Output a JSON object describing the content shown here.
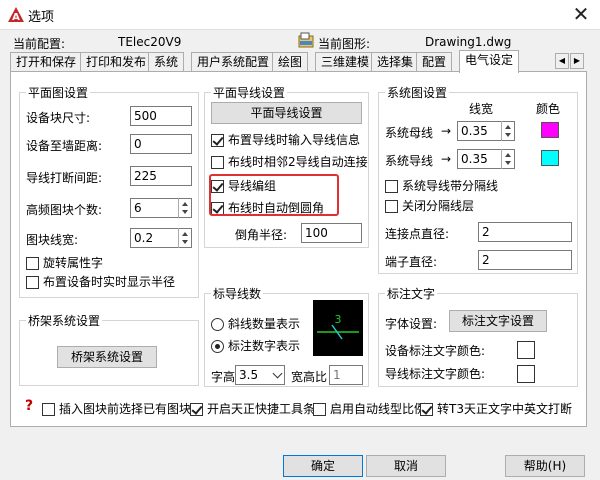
{
  "window": {
    "title": "选项",
    "close_glyph": "✕"
  },
  "info": {
    "config_label": "当前配置:",
    "config_value": "TElec20V9",
    "drawing_label": "当前图形:",
    "drawing_value": "Drawing1.dwg"
  },
  "tabs": [
    "打开和保存",
    "打印和发布",
    "系统",
    "用户系统配置",
    "绘图",
    "三维建模",
    "选择集",
    "配置",
    "电气设定"
  ],
  "tab_scroll": {
    "left": "◀",
    "right": "▶"
  },
  "plane_device": {
    "title": "平面图设置",
    "device_size_label": "设备块尺寸:",
    "device_size_value": "500",
    "device_wall_label": "设备至墙距离:",
    "device_wall_value": "0",
    "wire_gap_label": "导线打断间距:",
    "wire_gap_value": "225",
    "hf_count_label": "高频图块个数:",
    "hf_count_value": "6",
    "line_width_label": "图块线宽:",
    "line_width_value": "0.2",
    "rotate_attr": "旋转属性字",
    "show_radius": "布置设备时实时显示半径"
  },
  "plane_wire": {
    "title": "平面导线设置",
    "button": "平面导线设置",
    "input_info": "布置导线时输入导线信息",
    "auto_connect": "布线时相邻2导线自动连接",
    "group": "导线编组",
    "auto_fillet": "布线时自动倒圆角",
    "fillet_label": "倒角半径:",
    "fillet_value": "100"
  },
  "system_diagram": {
    "title": "系统图设置",
    "col_width": "线宽",
    "col_color": "颜色",
    "bus_label": "系统母线",
    "bus_width": "0.35",
    "wire_label": "系统导线",
    "wire_width": "0.35",
    "arrow": "→",
    "with_gap": "系统导线带分隔线",
    "close_layer": "关闭分隔线层",
    "joint_label": "连接点直径:",
    "joint_value": "2",
    "terminal_label": "端子直径:",
    "terminal_value": "2",
    "bus_color": "#ff00ff",
    "wire_color": "#00ffff"
  },
  "bridge": {
    "title": "桥架系统设置",
    "button": "桥架系统设置"
  },
  "wire_count": {
    "title": "标导线数",
    "slash": "斜线数量表示",
    "digit": "标注数字表示",
    "height_label": "字高",
    "height_value": "3.5",
    "ratio_label": "宽高比",
    "ratio_value": "1",
    "preview_number": "3"
  },
  "annotation": {
    "title": "标注文字",
    "font_label": "字体设置:",
    "font_button": "标注文字设置",
    "device_color_label": "设备标注文字颜色:",
    "wire_color_label": "导线标注文字颜色:"
  },
  "bottom_checks": {
    "help": "?",
    "insert_select": "插入图块前选择已有图块",
    "toolbar": "开启天正快捷工具条",
    "auto_linetype": "启用自动线型比例",
    "t3_text": "转T3天正文字中英文打断"
  },
  "footer": {
    "ok": "确定",
    "cancel": "取消",
    "help": "帮助(H)"
  }
}
